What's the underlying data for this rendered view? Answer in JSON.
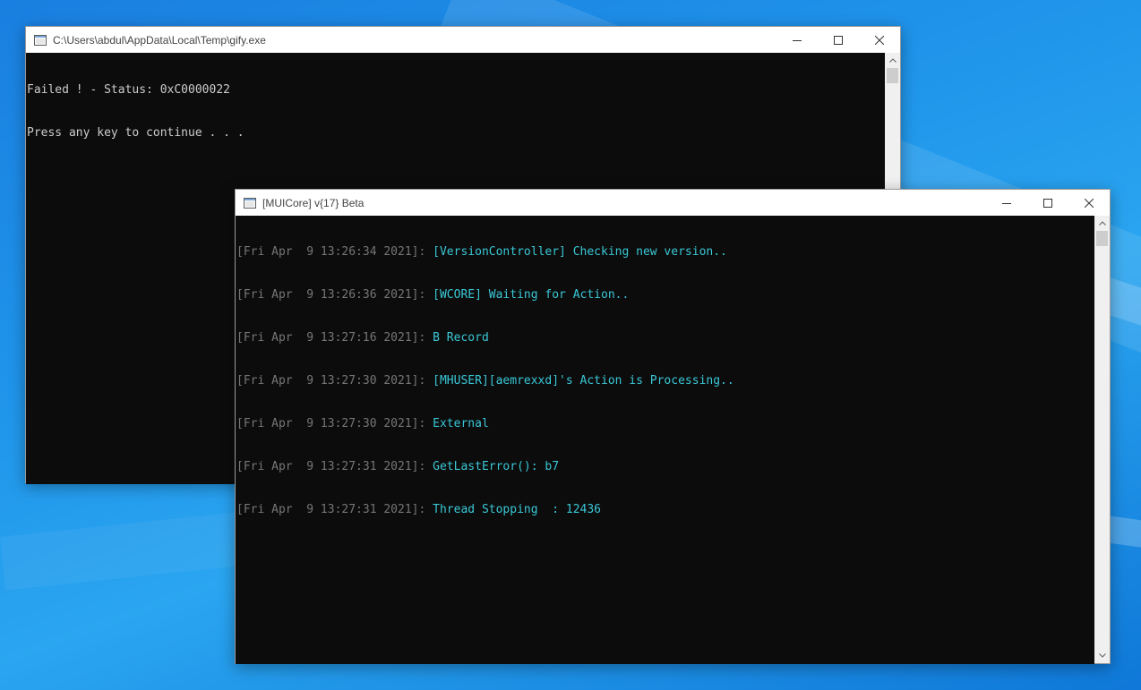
{
  "colors": {
    "console_bg": "#0c0c0c",
    "timestamp": "#767676",
    "message": "#3ac7d6",
    "plain_text": "#cccccc",
    "titlebar": "#ffffff",
    "desktop": "#1f94ea"
  },
  "window1": {
    "title": "C:\\Users\\abdul\\AppData\\Local\\Temp\\gify.exe",
    "icon": "console-app-icon",
    "lines": [
      "Failed ! - Status: 0xC0000022",
      "Press any key to continue . . ."
    ]
  },
  "window2": {
    "title": "[MUICore] v{17} Beta",
    "icon": "console-app-icon",
    "log": [
      {
        "timestamp": "[Fri Apr  9 13:26:34 2021]: ",
        "message": "[VersionController] Checking new version.."
      },
      {
        "timestamp": "[Fri Apr  9 13:26:36 2021]: ",
        "message": "[WCORE] Waiting for Action.."
      },
      {
        "timestamp": "[Fri Apr  9 13:27:16 2021]: ",
        "message": "B Record"
      },
      {
        "timestamp": "[Fri Apr  9 13:27:30 2021]: ",
        "message": "[MHUSER][aemrexxd]'s Action is Processing.."
      },
      {
        "timestamp": "[Fri Apr  9 13:27:30 2021]: ",
        "message": "External"
      },
      {
        "timestamp": "[Fri Apr  9 13:27:31 2021]: ",
        "message": "GetLastError(): b7"
      },
      {
        "timestamp": "[Fri Apr  9 13:27:31 2021]: ",
        "message": "Thread Stopping  : 12436"
      }
    ]
  }
}
